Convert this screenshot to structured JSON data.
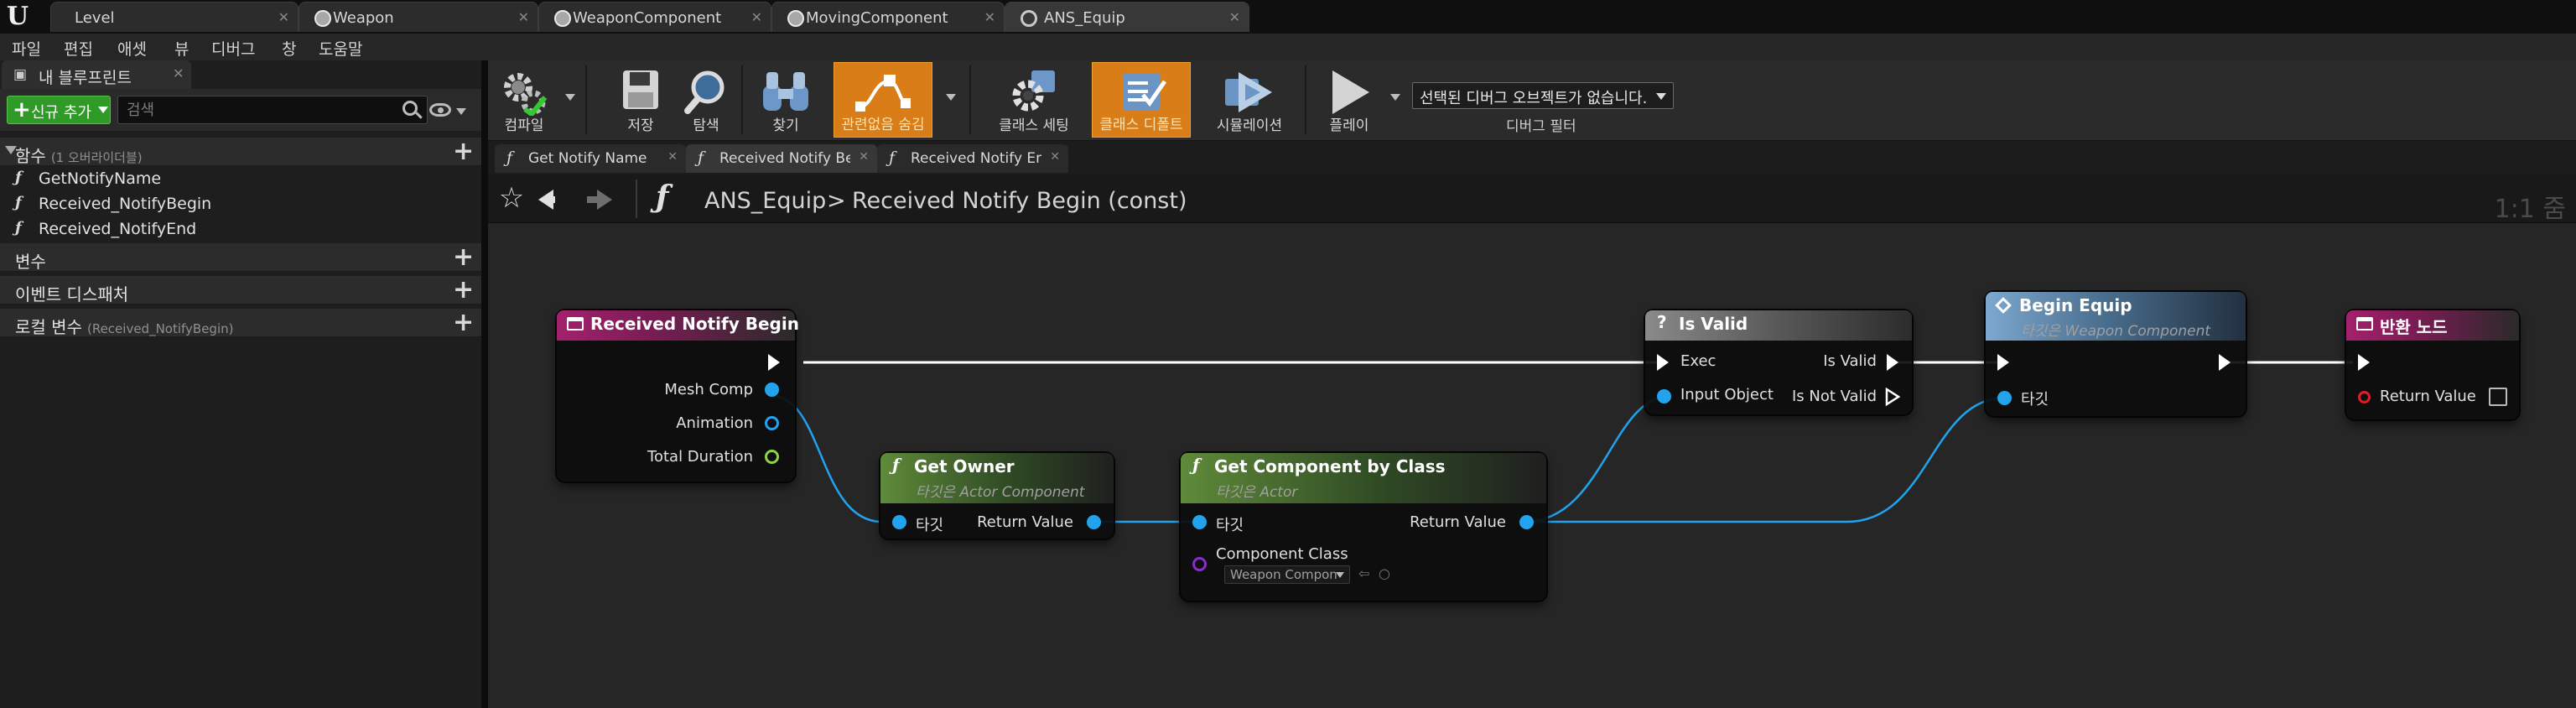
{
  "doc_tabs": [
    {
      "label": "Level"
    },
    {
      "label": "Weapon"
    },
    {
      "label": "WeaponComponent"
    },
    {
      "label": "MovingComponent"
    },
    {
      "label": "ANS_Equip"
    }
  ],
  "menu": [
    "파일",
    "편집",
    "애셋",
    "뷰",
    "디버그",
    "창",
    "도움말"
  ],
  "my_blueprint": {
    "title": "내 블루프린트",
    "add_new": "신규 추가",
    "search_placeholder": "검색",
    "functions": {
      "label": "함수",
      "note": "(1 오버라이더블)",
      "items": [
        "GetNotifyName",
        "Received_NotifyBegin",
        "Received_NotifyEnd"
      ]
    },
    "variables": "변수",
    "event_dispatchers": "이벤트 디스패처",
    "local_vars": {
      "label": "로컬 변수",
      "note": "(Received_NotifyBegin)"
    }
  },
  "toolbar": {
    "compile": "컴파일",
    "save": "저장",
    "browse": "탐색",
    "find": "찾기",
    "hide_unrelated": "관련없음 숨김",
    "class_settings": "클래스 세팅",
    "class_defaults": "클래스 디폴트",
    "simulation": "시뮬레이션",
    "play": "플레이",
    "debug_object": "선택된 디버그 오브젝트가 없습니다.",
    "debug_filter": "디버그 필터"
  },
  "graph_tabs": [
    "Get Notify Name",
    "Received Notify Begin",
    "Received Notify End"
  ],
  "breadcrumb": {
    "blueprint": "ANS_Equip",
    "separator": ">",
    "graph": "Received Notify Begin (const)"
  },
  "zoom": "1:1 줌",
  "nodes": {
    "entry": {
      "title": "Received Notify Begin",
      "pins": [
        "Mesh Comp",
        "Animation",
        "Total Duration"
      ]
    },
    "get_owner": {
      "title": "Get Owner",
      "subtitle": "타깃은 Actor Component",
      "in": "타깃",
      "out": "Return Value"
    },
    "get_component": {
      "title": "Get Component by Class",
      "subtitle": "타깃은 Actor",
      "in": "타깃",
      "class_pin": "Component Class",
      "class_value": "Weapon Component",
      "out": "Return Value"
    },
    "is_valid": {
      "title": "Is Valid",
      "exec": "Exec",
      "input": "Input Object",
      "valid": "Is Valid",
      "not_valid": "Is Not Valid"
    },
    "begin_equip": {
      "title": "Begin Equip",
      "subtitle": "타깃은 Weapon Component",
      "target": "타깃"
    },
    "return": {
      "title": "반환 노드",
      "out": "Return Value"
    }
  },
  "colors": {
    "accent_orange": "#d87d18",
    "exec_wire": "#ffffff",
    "object_pin": "#21a3ee",
    "event_header": "#a4216d",
    "pure_header": "#5f8a3a",
    "call_header": "#7ea8cf"
  }
}
